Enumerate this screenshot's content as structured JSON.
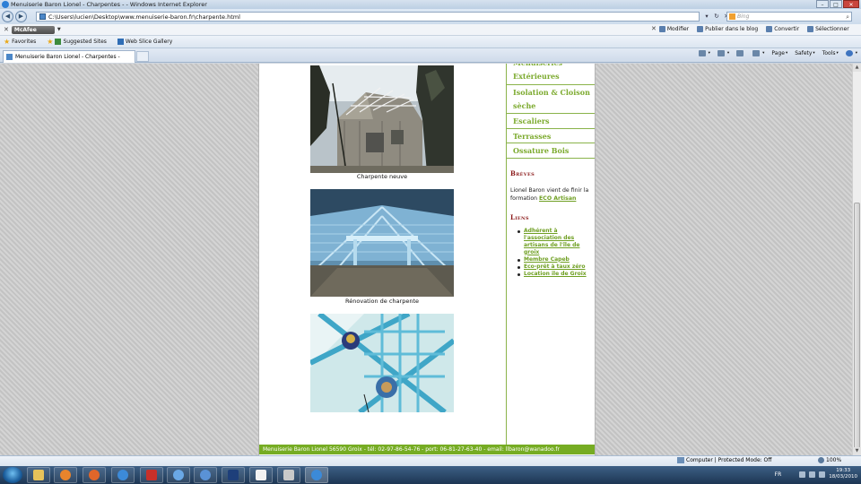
{
  "window": {
    "title": "Menuiserie Baron Lionel - Charpentes - - Windows Internet Explorer"
  },
  "address_bar": {
    "url": "C:\\Users\\lucien\\Desktop\\www.menuiserie-baron.fr\\charpente.html"
  },
  "search": {
    "placeholder": "Bing"
  },
  "toolbar": {
    "mcafee_label": "McAfee",
    "modifier_label": "Modifier",
    "publier_label": "Publier dans le blog",
    "convertir_label": "Convertir",
    "selectionner_label": "Sélectionner"
  },
  "favorites_bar": {
    "favorites_label": "Favorites",
    "suggested_label": "Suggested Sites",
    "webslice_label": "Web Slice Gallery"
  },
  "tab": {
    "title": "Menuiserie Baron Lionel - Charpentes -"
  },
  "command_bar": {
    "page_label": "Page",
    "safety_label": "Safety",
    "tools_label": "Tools"
  },
  "content": {
    "photos": [
      {
        "caption": "Charpente neuve"
      },
      {
        "caption": "Rénovation de charpente"
      },
      {
        "caption": ""
      }
    ]
  },
  "sidebar": {
    "menu": [
      "Menuiseries Extérieures",
      "Isolation & Cloison sèche",
      "Escaliers",
      "Terrasses",
      "Ossature Bois"
    ],
    "breves_title": "Brèves",
    "breves_text": "Lionel Baron vient de finir la formation",
    "breves_link": "ECO Artisan",
    "liens_title": "Liens",
    "links": [
      "Adhérent à l'association des artisans de l'île de groix",
      "Membre Capeb",
      "Eco-prêt à taux zéro",
      "Location ile de Groix"
    ]
  },
  "footer": {
    "text": "Menuiserie Baron Lionel 56590 Groix - tél: 02-97-86-54-76 - port: 06-81-27-63-40 - email: llbaron@wanadoo.fr"
  },
  "status_bar": {
    "zone": "Computer | Protected Mode: Off",
    "zoom": "100%"
  },
  "taskbar": {
    "lang": "FR",
    "time": "19:33",
    "date": "18/03/2010"
  }
}
